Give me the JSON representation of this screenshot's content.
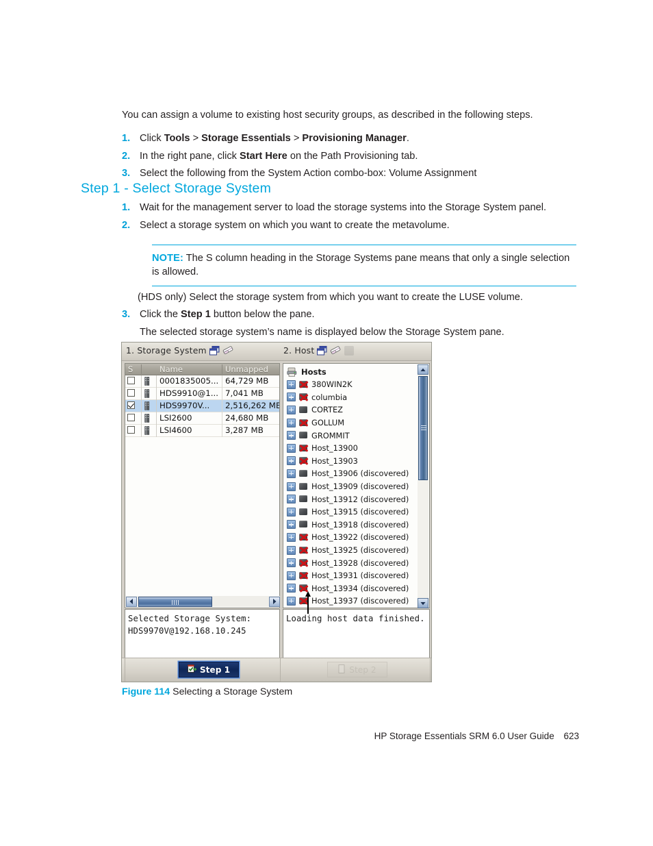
{
  "document": {
    "intro": "You can assign a volume to existing host security groups, as described in the following steps.",
    "steps_top": [
      {
        "num": "1.",
        "html": "Click <b>Tools</b> > <b>Storage Essentials</b> > <b>Provisioning Manager</b>."
      },
      {
        "num": "2.",
        "html": "In the right pane, click <b>Start Here</b> on the Path Provisioning tab."
      },
      {
        "num": "3.",
        "html": "Select the following from the System Action combo-box: Volume Assignment"
      }
    ],
    "heading": "Step 1 - Select Storage System",
    "steps_mid": [
      {
        "num": "1.",
        "html": "Wait for the management server to load the storage systems into the Storage System panel."
      },
      {
        "num": "2.",
        "html": "Select a storage system on which you want to create the metavolume."
      }
    ],
    "note_label": "NOTE:",
    "note_text": "The S column heading in the Storage Systems pane means that only a single selection is allowed.",
    "para_hds": "(HDS only) Select the storage system from which you want to create the LUSE volume.",
    "steps_bottom": [
      {
        "num": "3.",
        "html": "Click the <b>Step 1</b> button below the pane."
      }
    ],
    "sub_para": "The selected storage system’s name is displayed below the Storage System pane.",
    "figure_number": "Figure 114",
    "figure_title": "Selecting a Storage System",
    "footer_text": "HP Storage Essentials SRM 6.0 User Guide",
    "footer_page": "623"
  },
  "screenshot": {
    "titlebar": {
      "left_label": "1. Storage System",
      "right_label": "2. Host",
      "icons": [
        "window-restore-icon",
        "eraser-icon"
      ]
    },
    "storage_table": {
      "columns": [
        "S",
        "",
        "Name",
        "Unmapped"
      ],
      "rows": [
        {
          "checked": false,
          "name": "0001835005...",
          "unmapped": "64,729 MB",
          "selected": false
        },
        {
          "checked": false,
          "name": "HDS9910@1...",
          "unmapped": "7,041 MB",
          "selected": false
        },
        {
          "checked": true,
          "name": "HDS9970V...",
          "unmapped": "2,516,262 MB",
          "selected": true
        },
        {
          "checked": false,
          "name": "LSI2600",
          "unmapped": "24,680 MB",
          "selected": false
        },
        {
          "checked": false,
          "name": "LSI4600",
          "unmapped": "3,287 MB",
          "selected": false
        }
      ]
    },
    "host_tree": {
      "root_label": "Hosts",
      "nodes": [
        {
          "label": "380WIN2K",
          "error": true
        },
        {
          "label": "columbia",
          "error": true
        },
        {
          "label": "CORTEZ",
          "error": false
        },
        {
          "label": "GOLLUM",
          "error": true
        },
        {
          "label": "GROMMIT",
          "error": false
        },
        {
          "label": "Host_13900",
          "error": true
        },
        {
          "label": "Host_13903",
          "error": true
        },
        {
          "label": "Host_13906 (discovered)",
          "error": false
        },
        {
          "label": "Host_13909 (discovered)",
          "error": false
        },
        {
          "label": "Host_13912 (discovered)",
          "error": false
        },
        {
          "label": "Host_13915 (discovered)",
          "error": false
        },
        {
          "label": "Host_13918 (discovered)",
          "error": false
        },
        {
          "label": "Host_13922 (discovered)",
          "error": true
        },
        {
          "label": "Host_13925 (discovered)",
          "error": true
        },
        {
          "label": "Host_13928 (discovered)",
          "error": true
        },
        {
          "label": "Host_13931 (discovered)",
          "error": true
        },
        {
          "label": "Host_13934 (discovered)",
          "error": true
        },
        {
          "label": "Host_13937 (discovered)",
          "error": true
        }
      ]
    },
    "status_left": "Selected Storage System:\nHDS9970V@192.168.10.245",
    "status_right": "Loading host data finished.",
    "buttons": {
      "step1_label": "Step 1",
      "step2_label": "Step 2"
    }
  },
  "colors": {
    "accent": "#00a7dd",
    "selection": "#bcd6f0",
    "error": "#cc1418",
    "button_active": "#1b3468"
  }
}
